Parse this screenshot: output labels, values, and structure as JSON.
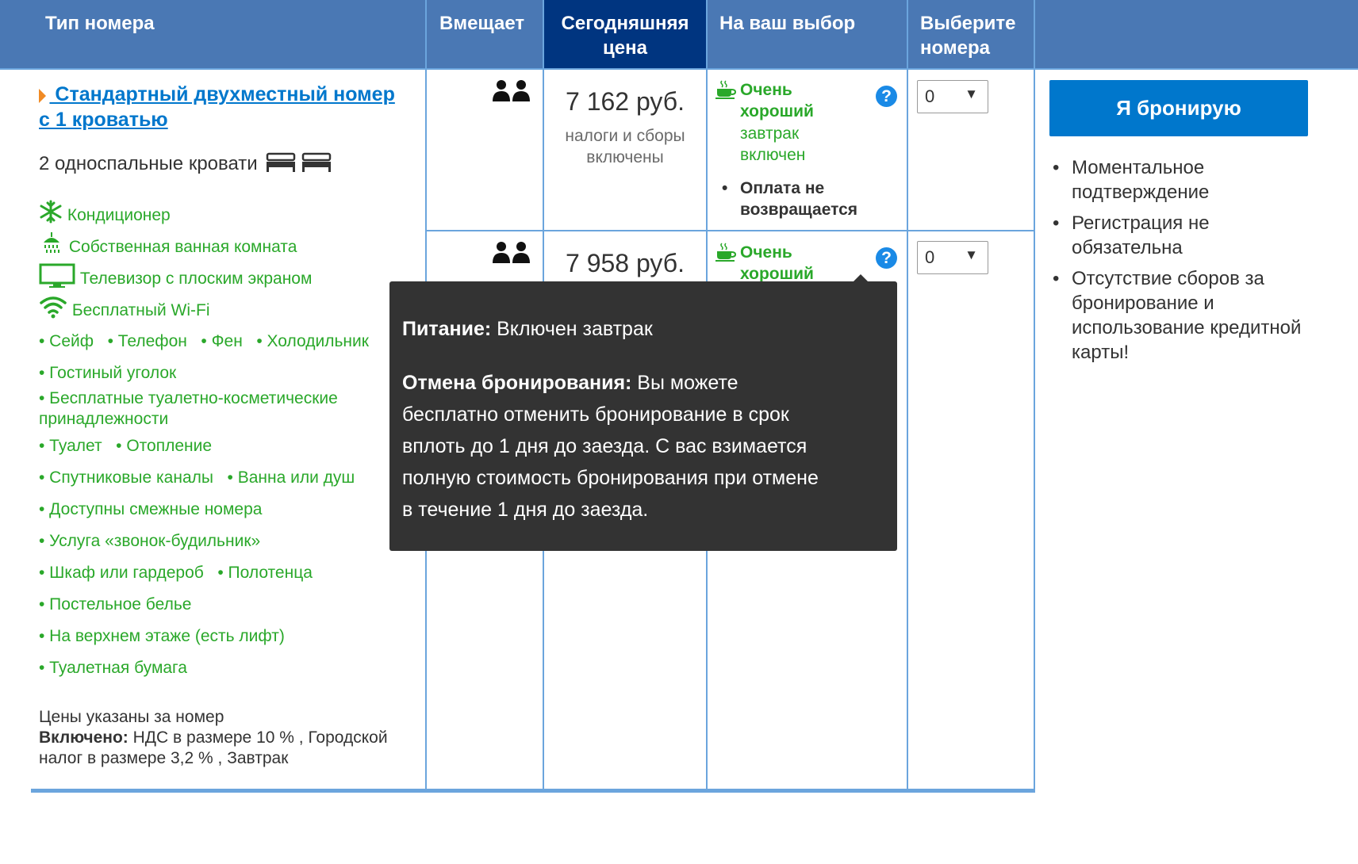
{
  "header": {
    "col_room_type": "Тип номера",
    "col_capacity": "Вмещает",
    "col_today_price_line1": "Сегодняшняя",
    "col_today_price_line2": "цена",
    "col_choice": "На ваш выбор",
    "col_select_line1": "Выберите",
    "col_select_line2": "номера"
  },
  "room": {
    "title_line1": " Стандартный двухместный номер",
    "title_line2": "с 1 кроватью",
    "beds": "2 односпальные кровати",
    "facilities_main": [
      {
        "icon": "snowflake-icon",
        "label": "Кондиционер"
      },
      {
        "icon": "shower-icon",
        "label": "Собственная ванная комната"
      },
      {
        "icon": "tv-icon",
        "label": "Телевизор с плоским экраном"
      },
      {
        "icon": "wifi-icon",
        "label": "Бесплатный Wi-Fi"
      }
    ],
    "facilities_bullets": {
      "row1": [
        "• Сейф",
        "• Телефон",
        "• Фен",
        "• Холодильник"
      ],
      "row2": "• Гостиный уголок",
      "row3_line1": "• Бесплатные туалетно-косметические",
      "row3_line2": "принадлежности",
      "row4": [
        "• Туалет",
        "• Отопление"
      ],
      "row5": [
        "• Спутниковые каналы",
        "• Ванна или душ"
      ],
      "row6": "• Доступны смежные номера",
      "row7": "• Услуга «звонок-будильник»",
      "row8": [
        "• Шкаф или гардероб",
        "• Полотенца"
      ],
      "row9": "• Постельное белье",
      "row10": "• На верхнем этаже (есть лифт)",
      "row11": "• Туалетная бумага"
    },
    "price_note": "Цены указаны за номер",
    "included_label": "Включено:",
    "included_line1": " НДС в размере 10 % , Городской",
    "included_line2": "налог в размере 3,2 % , Завтрак"
  },
  "offers": [
    {
      "price": "7 162 руб.",
      "tax_line1": "налоги и сборы",
      "tax_line2": "включены",
      "rating_line1": "Очень",
      "rating_line2": "хороший",
      "breakfast_line1": "завтрак",
      "breakfast_line2": "включен",
      "policy_line1": "Оплата не",
      "policy_line2": "возвращается",
      "quantity": "0"
    },
    {
      "price": "7 958 руб.",
      "rating_line1": "Очень",
      "rating_line2": "хороший",
      "quantity": "0"
    }
  ],
  "booking": {
    "button": "Я бронирую",
    "benefits": [
      "Моментальное подтверждение",
      "Регистрация не обязательна",
      "Отсутствие сборов за бронирование и использование кредитной карты!"
    ]
  },
  "tooltip": {
    "meal_label": "Питание:",
    "meal_value": " Включен завтрак",
    "cancel_label": "Отмена бронирования:",
    "cancel_line1": " Вы можете",
    "cancel_line2": "бесплатно отменить бронирование в срок",
    "cancel_line3": "вплоть до 1 дня до заезда. С вас взимается",
    "cancel_line4": "полную стоимость бронирования при отмене",
    "cancel_line5": "в течение 1 дня до заезда."
  },
  "colors": {
    "header_blue": "#4a78b4",
    "header_dark_blue": "#003580",
    "link_blue": "#0077cc",
    "green": "#2aa82a",
    "tooltip_bg": "#333333"
  }
}
